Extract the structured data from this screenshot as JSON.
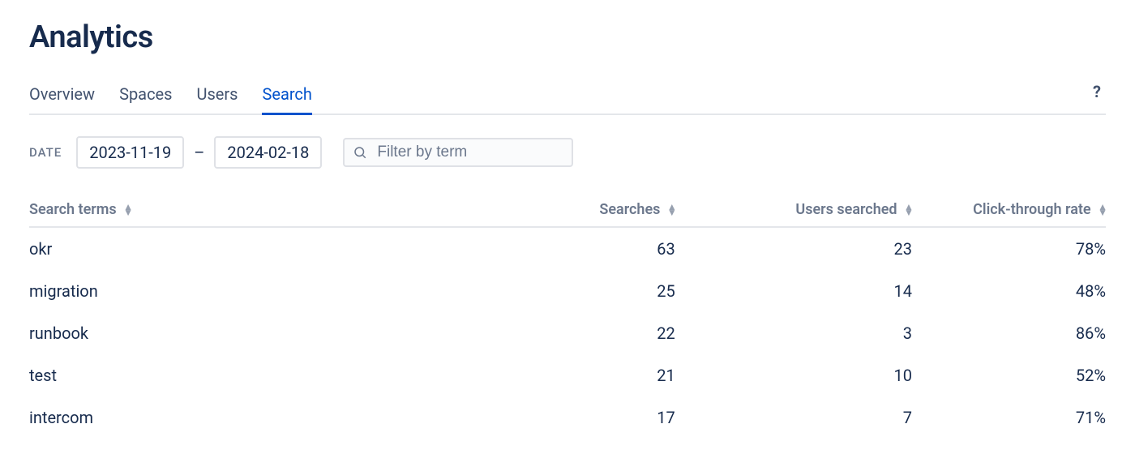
{
  "page_title": "Analytics",
  "tabs": [
    {
      "label": "Overview",
      "active": false
    },
    {
      "label": "Spaces",
      "active": false
    },
    {
      "label": "Users",
      "active": false
    },
    {
      "label": "Search",
      "active": true
    }
  ],
  "date_filter": {
    "label": "DATE",
    "from": "2023-11-19",
    "separator": "–",
    "to": "2024-02-18"
  },
  "term_filter": {
    "placeholder": "Filter by term",
    "value": ""
  },
  "columns": {
    "term": "Search terms",
    "searches": "Searches",
    "users": "Users searched",
    "ctr": "Click-through rate"
  },
  "rows": [
    {
      "term": "okr",
      "searches": "63",
      "users": "23",
      "ctr": "78%"
    },
    {
      "term": "migration",
      "searches": "25",
      "users": "14",
      "ctr": "48%"
    },
    {
      "term": "runbook",
      "searches": "22",
      "users": "3",
      "ctr": "86%"
    },
    {
      "term": "test",
      "searches": "21",
      "users": "10",
      "ctr": "52%"
    },
    {
      "term": "intercom",
      "searches": "17",
      "users": "7",
      "ctr": "71%"
    }
  ]
}
